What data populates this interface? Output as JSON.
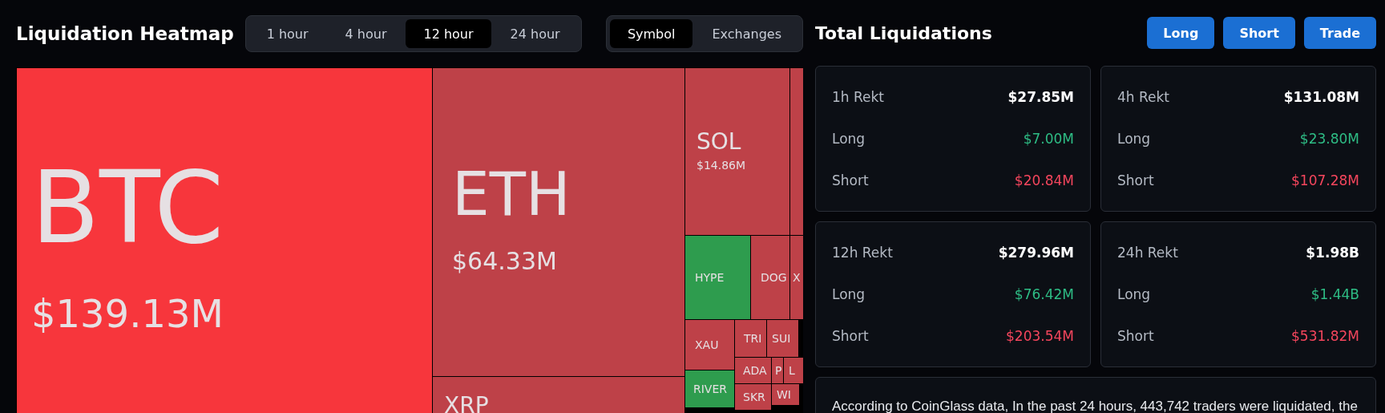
{
  "heatmap": {
    "title": "Liquidation Heatmap",
    "time_tabs": [
      {
        "label": "1 hour",
        "selected": false
      },
      {
        "label": "4 hour",
        "selected": false
      },
      {
        "label": "12 hour",
        "selected": true
      },
      {
        "label": "24 hour",
        "selected": false
      }
    ],
    "view_tabs": [
      {
        "label": "Symbol",
        "selected": true
      },
      {
        "label": "Exchanges",
        "selected": false
      }
    ],
    "tiles": [
      {
        "symbol": "BTC",
        "value": "$139.13M",
        "color": "#f7363c"
      },
      {
        "symbol": "ETH",
        "value": "$64.33M",
        "color": "#be4148"
      },
      {
        "symbol": "XRP",
        "color": "#be4148"
      },
      {
        "symbol": "SOL",
        "value": "$14.86M",
        "color": "#be4148"
      },
      {
        "color": "#be4148"
      },
      {
        "symbol": "HYPE",
        "color": "#2e9c4e"
      },
      {
        "symbol": "DOG",
        "color": "#be4148"
      },
      {
        "symbol": "X",
        "color": "#be4148"
      },
      {
        "symbol": "XAU",
        "color": "#be4148"
      },
      {
        "symbol": "TRI",
        "color": "#be4148"
      },
      {
        "symbol": "SUI",
        "color": "#be4148"
      },
      {
        "symbol": "ADA",
        "color": "#be4148"
      },
      {
        "symbol": "P",
        "color": "#be4148"
      },
      {
        "symbol": "L",
        "color": "#be4148"
      },
      {
        "symbol": "RIVER",
        "color": "#2e9c4e"
      },
      {
        "symbol": "SKR",
        "color": "#be4148"
      },
      {
        "symbol": "WI",
        "color": "#be4148"
      }
    ]
  },
  "totals": {
    "title": "Total Liquidations",
    "buttons": [
      "Long",
      "Short",
      "Trade"
    ],
    "cards": [
      {
        "label": "1h Rekt",
        "total": "$27.85M",
        "long_label": "Long",
        "long": "$7.00M",
        "short_label": "Short",
        "short": "$20.84M"
      },
      {
        "label": "4h Rekt",
        "total": "$131.08M",
        "long_label": "Long",
        "long": "$23.80M",
        "short_label": "Short",
        "short": "$107.28M"
      },
      {
        "label": "12h Rekt",
        "total": "$279.96M",
        "long_label": "Long",
        "long": "$76.42M",
        "short_label": "Short",
        "short": "$203.54M"
      },
      {
        "label": "24h Rekt",
        "total": "$1.98B",
        "long_label": "Long",
        "long": "$1.44B",
        "short_label": "Short",
        "short": "$531.82M"
      }
    ],
    "summary": "According to CoinGlass data, In the past 24 hours, 443,742 traders were liquidated, the"
  }
}
